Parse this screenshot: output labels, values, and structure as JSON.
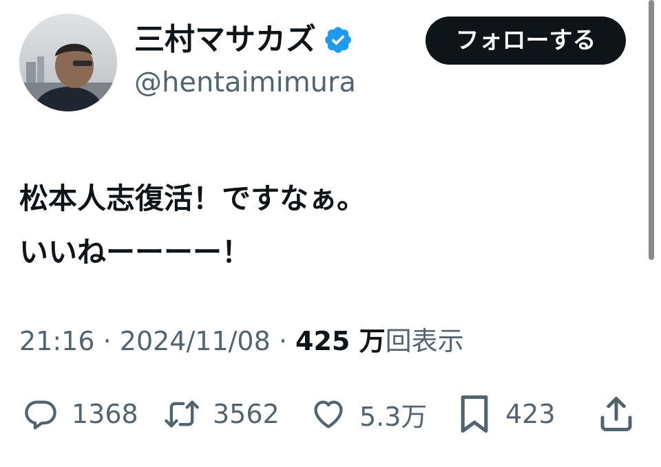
{
  "user": {
    "display_name": "三村マサカズ",
    "handle": "@hentaimimura",
    "verified": true
  },
  "follow_button": {
    "label": "フォローする"
  },
  "tweet": {
    "lines": [
      "松本人志復活！ですなぁ。",
      "いいねーーーー！"
    ]
  },
  "meta": {
    "time": "21:16",
    "separator": " · ",
    "date": "2024/11/08",
    "views_count": "425 万",
    "views_label": "回表示"
  },
  "actions": {
    "replies": "1368",
    "reposts": "3562",
    "likes": "5.3万",
    "bookmarks": "423"
  },
  "colors": {
    "primary_text": "#0f1419",
    "secondary_text": "#536471",
    "verified_blue": "#1d9bf0",
    "button_bg": "#0f1419"
  },
  "icons": [
    "verified-badge-icon",
    "reply-icon",
    "repost-icon",
    "like-icon",
    "bookmark-icon",
    "share-icon"
  ]
}
